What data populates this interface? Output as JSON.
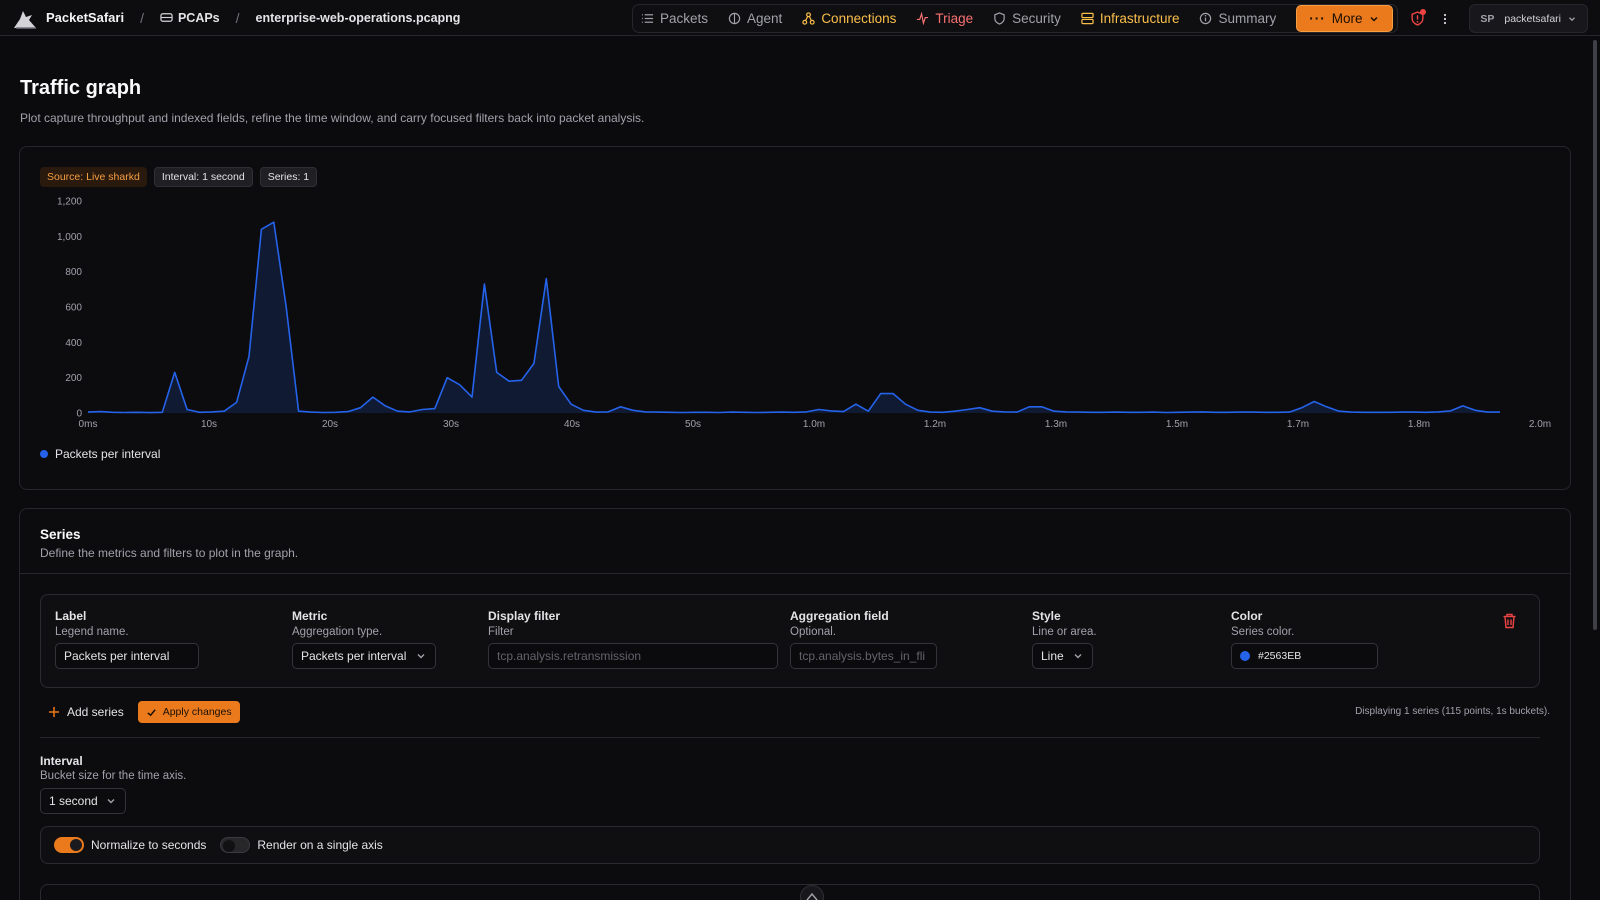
{
  "app": {
    "name": "PacketSafari",
    "breadcrumbs": [
      "PCAPs",
      "enterprise-web-operations.pcapng"
    ]
  },
  "nav": {
    "items": [
      {
        "label": "Packets",
        "icon": "list-icon",
        "color": "#a1a1aa"
      },
      {
        "label": "Agent",
        "icon": "agent-icon",
        "color": "#a1a1aa"
      },
      {
        "label": "Connections",
        "icon": "connections-icon",
        "color": "#fbbf4a"
      },
      {
        "label": "Triage",
        "icon": "pulse-icon",
        "color": "#f87171"
      },
      {
        "label": "Security",
        "icon": "shield-icon",
        "color": "#a1a1aa"
      },
      {
        "label": "Infrastructure",
        "icon": "server-icon",
        "color": "#fbbf4a"
      },
      {
        "label": "Summary",
        "icon": "info-icon",
        "color": "#a1a1aa"
      }
    ],
    "more_label": "More",
    "accent": "#ea7a1c"
  },
  "user": {
    "initials": "SP",
    "name": "packetsafari"
  },
  "page": {
    "title": "Traffic graph",
    "subtitle": "Plot capture throughput and indexed fields, refine the time window, and carry focused filters back into packet analysis."
  },
  "badges": {
    "source": "Source: Live sharkd",
    "interval": "Interval: 1 second",
    "series": "Series: 1"
  },
  "chart_data": {
    "type": "area",
    "series": [
      {
        "name": "Packets per interval",
        "color": "#2563eb",
        "x": [
          0,
          1,
          2,
          3,
          4,
          5,
          6,
          7,
          8,
          9,
          10,
          11,
          12,
          13,
          14,
          15,
          16,
          17,
          18,
          19,
          20,
          21,
          22,
          23,
          24,
          25,
          26,
          27,
          28,
          29,
          30,
          31,
          32,
          33,
          34,
          35,
          36,
          37,
          38,
          39,
          40,
          41,
          42,
          43,
          44,
          45,
          46,
          47,
          48,
          49,
          50,
          51,
          52,
          53,
          54,
          55,
          56,
          57,
          58,
          59,
          60,
          61,
          62,
          63,
          64,
          65,
          66,
          67,
          68,
          69,
          70,
          71,
          72,
          73,
          74,
          75,
          76,
          77,
          78,
          79,
          80,
          81,
          82,
          83,
          84,
          85,
          86,
          87,
          88,
          89,
          90,
          91,
          92,
          93,
          94,
          95,
          96,
          97,
          98,
          99,
          100,
          101,
          102,
          103,
          104,
          105,
          106,
          107,
          108,
          109,
          110,
          111,
          112,
          113,
          114
        ],
        "values": [
          5,
          8,
          4,
          3,
          4,
          2,
          4,
          230,
          20,
          4,
          6,
          10,
          60,
          320,
          1040,
          1080,
          600,
          10,
          5,
          3,
          4,
          8,
          30,
          90,
          40,
          10,
          6,
          20,
          25,
          200,
          160,
          90,
          730,
          230,
          180,
          185,
          280,
          760,
          150,
          50,
          15,
          5,
          6,
          35,
          15,
          6,
          5,
          4,
          3,
          4,
          4,
          3,
          5,
          4,
          3,
          4,
          5,
          4,
          6,
          20,
          12,
          8,
          50,
          10,
          110,
          110,
          50,
          15,
          5,
          4,
          10,
          20,
          30,
          10,
          6,
          5,
          35,
          35,
          10,
          6,
          5,
          4,
          4,
          5,
          4,
          4,
          5,
          3,
          4,
          5,
          6,
          4,
          4,
          5,
          5,
          4,
          4,
          5,
          30,
          65,
          35,
          10,
          5,
          4,
          4,
          4,
          5,
          5,
          4,
          6,
          12,
          40,
          15,
          5,
          5
        ]
      }
    ],
    "yticks": [
      "0",
      "200",
      "400",
      "600",
      "800",
      "1,000",
      "1,200"
    ],
    "xticks": [
      "0ms",
      "10s",
      "20s",
      "30s",
      "40s",
      "50s",
      "1.0m",
      "1.2m",
      "1.3m",
      "1.5m",
      "1.7m",
      "1.8m",
      "2.0m"
    ],
    "ylim": [
      0,
      1200
    ],
    "legend": "Packets per interval",
    "legend_position": "bottom-left"
  },
  "series_panel": {
    "title": "Series",
    "subtitle": "Define the metrics and filters to plot in the graph.",
    "fields": {
      "label": {
        "title": "Label",
        "hint": "Legend name.",
        "value": "Packets per interval"
      },
      "metric": {
        "title": "Metric",
        "hint": "Aggregation type.",
        "value": "Packets per interval"
      },
      "filter": {
        "title": "Display filter",
        "hint": "Filter",
        "placeholder": "tcp.analysis.retransmission"
      },
      "aggregation": {
        "title": "Aggregation field",
        "hint": "Optional.",
        "placeholder": "tcp.analysis.bytes_in_fli"
      },
      "style": {
        "title": "Style",
        "hint": "Line or area.",
        "value": "Line"
      },
      "color": {
        "title": "Color",
        "hint": "Series color.",
        "value": "#2563EB"
      }
    },
    "add_series": "Add series",
    "apply": "Apply changes",
    "displaying": "Displaying 1 series (115 points, 1s buckets).",
    "interval": {
      "title": "Interval",
      "hint": "Bucket size for the time axis.",
      "value": "1 second"
    },
    "toggles": [
      {
        "label": "Normalize to seconds",
        "on": true
      },
      {
        "label": "Render on a single axis",
        "on": false
      }
    ]
  }
}
